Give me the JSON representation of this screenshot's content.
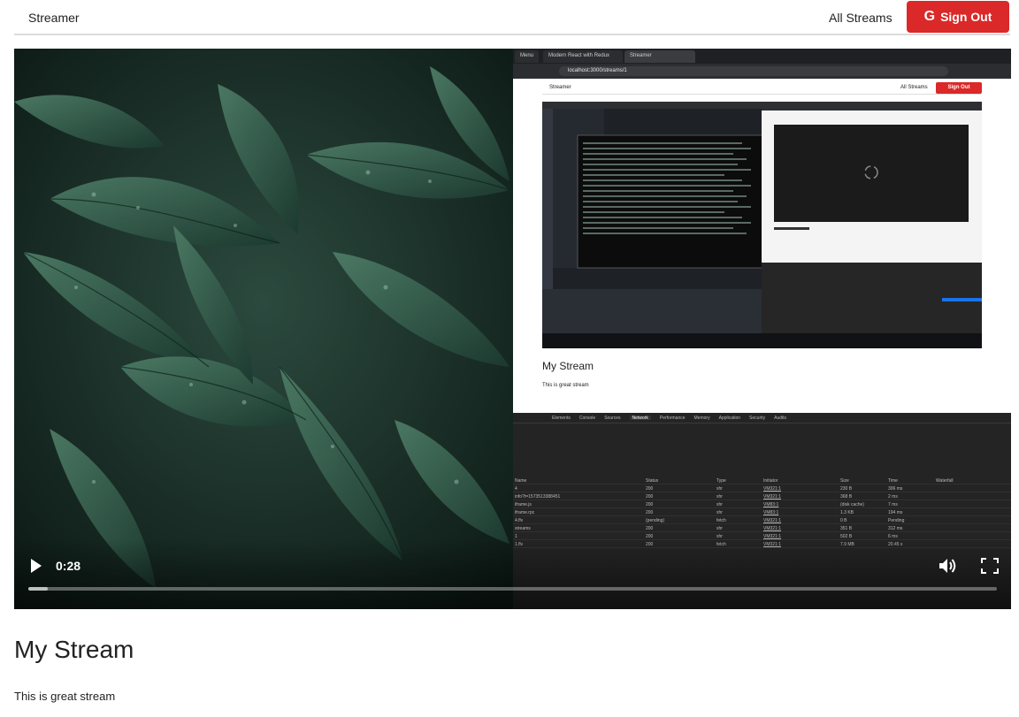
{
  "header": {
    "brand": "Streamer",
    "all_streams": "All Streams",
    "sign_out": "Sign Out",
    "sign_out_icon": "google-icon"
  },
  "video": {
    "time": "0:28",
    "progress": 0.02,
    "recorded": {
      "browser_tabs": [
        "Menu",
        "Modern React with Redux",
        "Streamer"
      ],
      "address": "localhost:3000/streams/1",
      "header_brand": "Streamer",
      "header_all": "All Streams",
      "header_sign_out": "Sign Out",
      "stream_title": "My Stream",
      "stream_desc": "This is great stream",
      "devtools_tabs": [
        "Elements",
        "Console",
        "Sources",
        "Network",
        "Performance",
        "Memory",
        "Application",
        "Security",
        "Audits"
      ],
      "devtools_active": "Network",
      "network_columns": [
        "Name",
        "Status",
        "Type",
        "Initiator",
        "Size",
        "Time",
        "Waterfall"
      ],
      "network_rows": [
        {
          "name": "4",
          "status": "200",
          "type": "xhr",
          "initiator": "VM321:1",
          "size": "230 B",
          "time": "306 ms"
        },
        {
          "name": "info?t=1573513388451",
          "status": "200",
          "type": "xhr",
          "initiator": "VM321:1",
          "size": "368 B",
          "time": "2 ms"
        },
        {
          "name": "iframe.js",
          "status": "200",
          "type": "xhr",
          "initiator": "VM83:1",
          "size": "(disk cache)",
          "time": "7 ms"
        },
        {
          "name": "iframe.rpc",
          "status": "200",
          "type": "xhr",
          "initiator": "VM83:1",
          "size": "1.3 KB",
          "time": "194 ms"
        },
        {
          "name": "4.flv",
          "status": "(pending)",
          "type": "fetch",
          "initiator": "VM321:1",
          "size": "0 B",
          "time": "Pending"
        },
        {
          "name": "streams",
          "status": "200",
          "type": "xhr",
          "initiator": "VM321:1",
          "size": "351 B",
          "time": "312 ms"
        },
        {
          "name": "1",
          "status": "200",
          "type": "xhr",
          "initiator": "VM321:1",
          "size": "502 B",
          "time": "6 ms"
        },
        {
          "name": "1.flv",
          "status": "200",
          "type": "fetch",
          "initiator": "VM321:1",
          "size": "7.9 MB",
          "time": "20.45 s"
        }
      ]
    }
  },
  "stream": {
    "title": "My Stream",
    "description": "This is great stream"
  },
  "colors": {
    "accent": "#db2828",
    "header_border": "#dcdcdc"
  }
}
